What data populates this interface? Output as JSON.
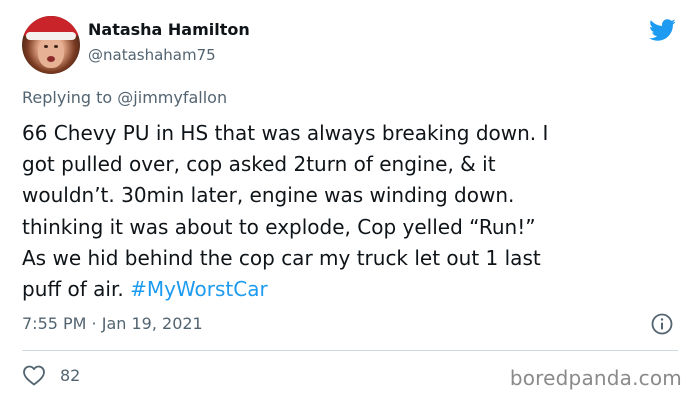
{
  "user": {
    "name": "Natasha Hamilton",
    "handle": "@natashaham75",
    "avatar_icon": "avatar-photo"
  },
  "reply": {
    "prefix": "Replying to ",
    "mention": "@jimmyfallon"
  },
  "tweet": {
    "lines": [
      "66 Chevy PU in HS that was always breaking down. I",
      "got pulled over, cop asked 2turn of engine, & it",
      "wouldn’t. 30min later, engine was winding down.",
      "thinking it was about to explode, Cop yelled “Run!”",
      "As we hid behind the cop car my truck let out 1 last"
    ],
    "last_line_text": "puff of air. ",
    "hashtag": "#MyWorstCar"
  },
  "meta": {
    "timestamp": "7:55 PM · Jan 19, 2021"
  },
  "engagement": {
    "likes": "82"
  },
  "watermark": {
    "text": "boredpanda.com"
  },
  "colors": {
    "brand": "#1d9bf0",
    "text": "#0f1419",
    "muted": "#536471",
    "divider": "#cfd9de"
  },
  "icons": {
    "logo": "twitter-bird-icon",
    "info": "info-icon",
    "like": "heart-icon"
  }
}
